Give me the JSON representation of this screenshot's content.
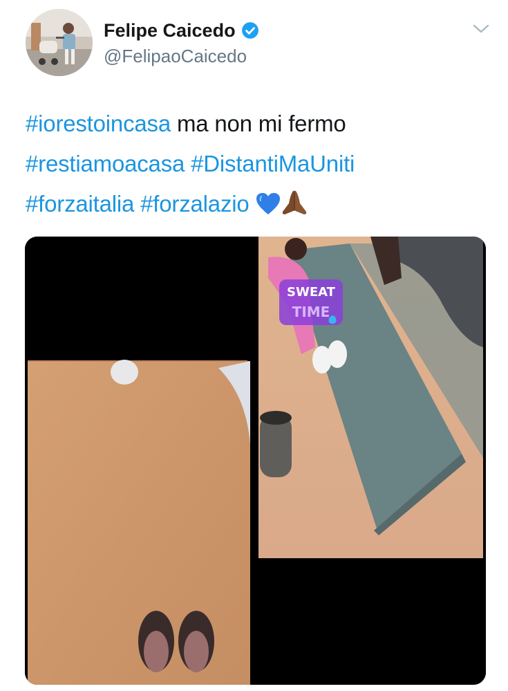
{
  "author": {
    "display_name": "Felipe Caicedo",
    "handle": "@FelipaoCaicedo",
    "verified": true,
    "avatar_icon": "profile-photo",
    "verified_icon": "verified-badge-icon",
    "menu_icon": "chevron-down-icon"
  },
  "tweet": {
    "lines": [
      [
        {
          "text": "#iorestoincasa",
          "hashtag": true
        },
        {
          "text": " ma non mi fermo",
          "hashtag": false
        }
      ],
      [
        {
          "text": "#restiamoacasa",
          "hashtag": true
        },
        {
          "text": " ",
          "hashtag": false
        },
        {
          "text": "#DistantiMaUniti",
          "hashtag": true
        }
      ],
      [
        {
          "text": "#forzaitalia",
          "hashtag": true
        },
        {
          "text": " ",
          "hashtag": false
        },
        {
          "text": "#forzalazio",
          "hashtag": true
        },
        {
          "text": " ",
          "hashtag": false
        }
      ]
    ],
    "emojis": [
      "blue-heart-icon",
      "folded-hands-icon"
    ]
  },
  "media": {
    "type": "video",
    "sticker_line1": "SWEAT",
    "sticker_line2": "TIME"
  },
  "colors": {
    "link": "#1b95e0",
    "text": "#14171a",
    "secondary": "#657786",
    "verified": "#1da1f2"
  }
}
